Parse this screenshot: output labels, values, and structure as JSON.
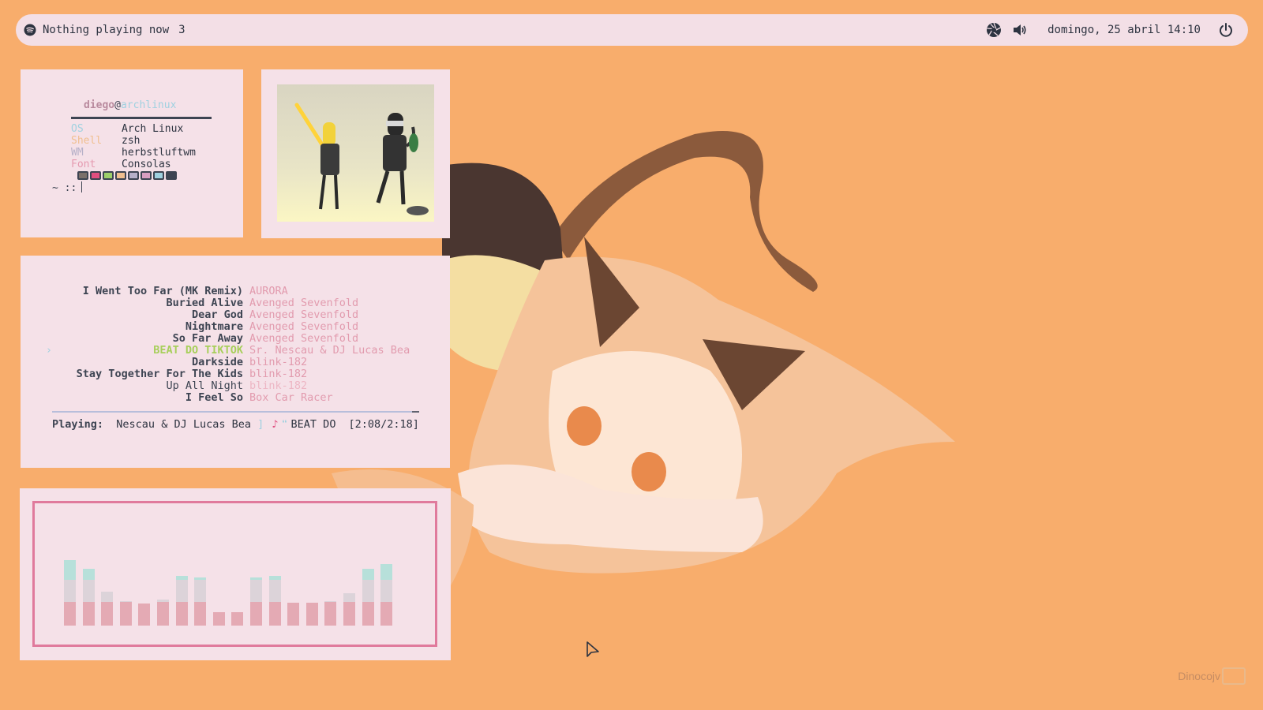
{
  "topbar": {
    "media_icon": "spotify-icon",
    "now_playing": "Nothing playing now",
    "workspace": "3",
    "icons": [
      "camera-aperture-icon",
      "volume-icon",
      "power-icon"
    ],
    "datetime": "domingo, 25 abril 14:10"
  },
  "fetch": {
    "username": "diego",
    "at": "@",
    "hostname": "archlinux",
    "rows": [
      {
        "key": "OS",
        "value": "Arch Linux"
      },
      {
        "key": "Shell",
        "value": "zsh"
      },
      {
        "key": "WM",
        "value": "herbstluftwm"
      },
      {
        "key": "Font",
        "value": "Consolas"
      }
    ],
    "swatch_colors": [
      "#7a6f6a",
      "#e04f7f",
      "#9dcf6a",
      "#f0bf8f",
      "#b6b0c8",
      "#d89ec0",
      "#9fd1e0",
      "#3d4452"
    ],
    "prompt": "~ ::"
  },
  "image_panel": {
    "icon": "robot-illustration"
  },
  "player": {
    "marker": "›",
    "tracks": [
      {
        "title": "I Went Too Far (MK Remix)",
        "artist": "AURORA"
      },
      {
        "title": "Buried Alive",
        "artist": "Avenged Sevenfold"
      },
      {
        "title": "Dear God",
        "artist": "Avenged Sevenfold"
      },
      {
        "title": "Nightmare",
        "artist": "Avenged Sevenfold"
      },
      {
        "title": "So Far Away",
        "artist": "Avenged Sevenfold"
      },
      {
        "title": "BEAT DO TIKTOK",
        "artist": "Sr. Nescau & DJ Lucas Bea"
      },
      {
        "title": "Darkside",
        "artist": "blink-182"
      },
      {
        "title": "Stay Together For The Kids",
        "artist": "blink-182"
      },
      {
        "title": "Up All Night",
        "artist": "blink-182"
      },
      {
        "title": "I Feel So",
        "artist": "Box Car Racer"
      }
    ],
    "now_label": "Playing:",
    "now_artist": "Nescau & DJ Lucas Bea",
    "bracket": "]",
    "now_title": "BEAT DO",
    "time": "[2:08/2:18]",
    "accent": "#a7cf5a"
  },
  "visualizer": {
    "levels": [
      0.72,
      0.63,
      0.37,
      0.27,
      0.24,
      0.29,
      0.55,
      0.53,
      0.15,
      0.15,
      0.53,
      0.55,
      0.25,
      0.25,
      0.27,
      0.36,
      0.63,
      0.68
    ],
    "colors": {
      "top": "#b7e0da",
      "mid": "#dcd3d9",
      "low": "#e4aab4",
      "frame": "#e07a9c"
    }
  },
  "watermark": {
    "text": "Dinocojv"
  }
}
